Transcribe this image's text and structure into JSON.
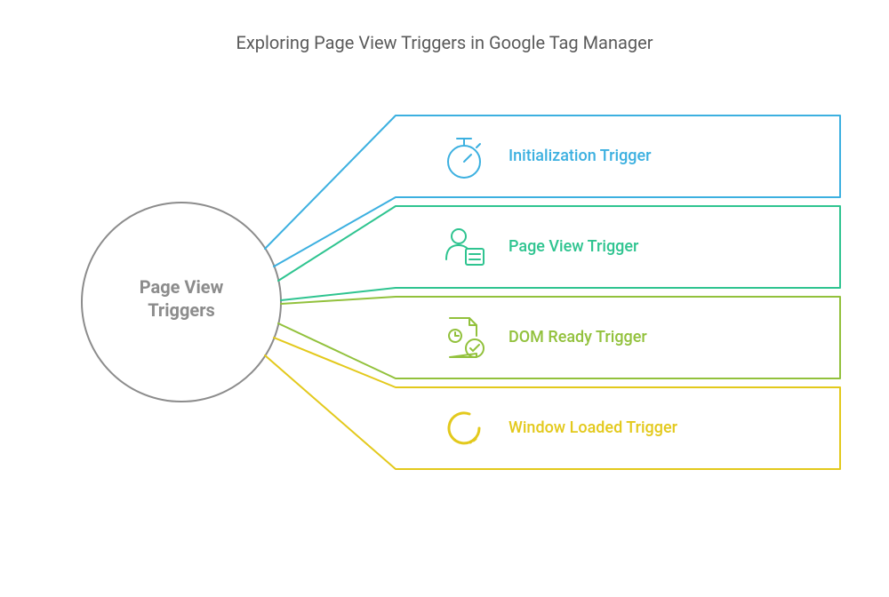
{
  "title": "Exploring Page View Triggers in Google Tag Manager",
  "hub": {
    "label": "Page View\nTriggers"
  },
  "rows": [
    {
      "icon": "stopwatch-icon",
      "label": "Initialization Trigger",
      "color": "#3cb0e0"
    },
    {
      "icon": "person-doc-icon",
      "label": "Page View Trigger",
      "color": "#2fc490"
    },
    {
      "icon": "doc-clock-check-icon",
      "label": "DOM Ready Trigger",
      "color": "#92c13c"
    },
    {
      "icon": "loading-ring-icon",
      "label": "Window Loaded Trigger",
      "color": "#e3c91c"
    }
  ]
}
